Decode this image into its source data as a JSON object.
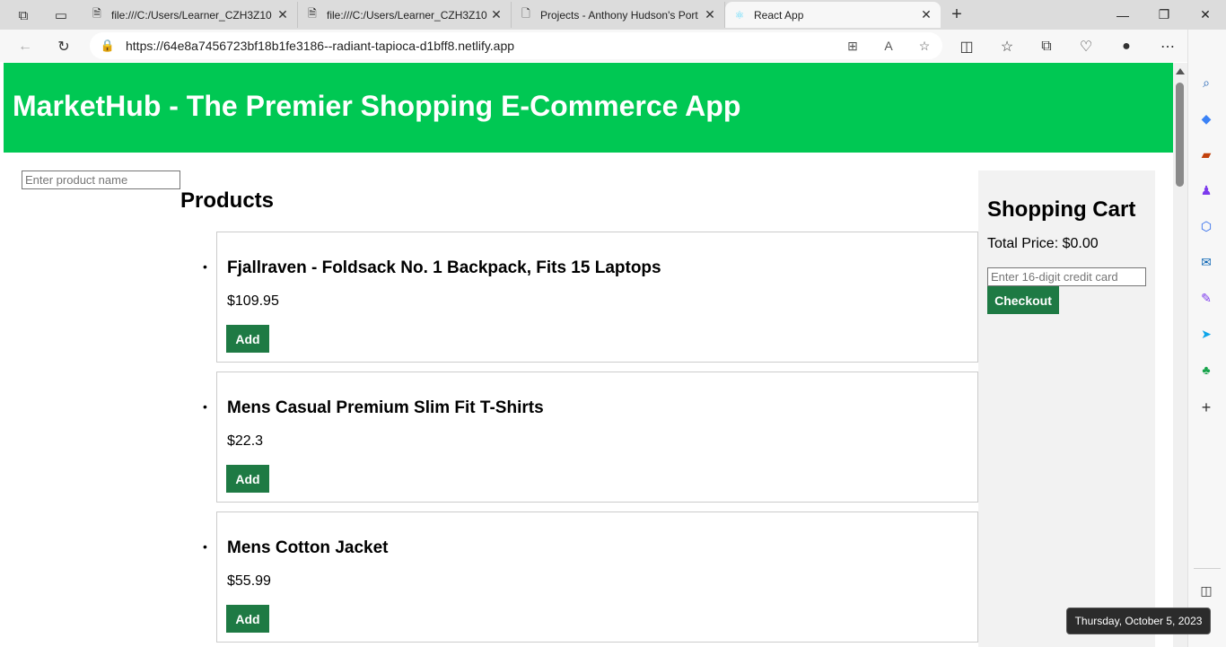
{
  "browser": {
    "tabs": [
      {
        "title": "file:///C:/Users/Learner_CZH3Z10",
        "icon": "file-pdf-icon",
        "active": false
      },
      {
        "title": "file:///C:/Users/Learner_CZH3Z10",
        "icon": "file-pdf-icon",
        "active": false
      },
      {
        "title": "Projects - Anthony Hudson's Port",
        "icon": "page-icon",
        "active": false
      },
      {
        "title": "React App",
        "icon": "react-icon",
        "active": true
      }
    ],
    "url": "https://64e8a7456723bf18b1fe3186--radiant-tapioca-d1bff8.netlify.app"
  },
  "app": {
    "title": "MarketHub - The Premier Shopping E-Commerce App",
    "search_placeholder": "Enter product name",
    "products_heading": "Products",
    "add_label": "Add",
    "products": [
      {
        "name": "Fjallraven - Foldsack No. 1 Backpack, Fits 15 Laptops",
        "price": "$109.95"
      },
      {
        "name": "Mens Casual Premium Slim Fit T-Shirts",
        "price": "$22.3"
      },
      {
        "name": "Mens Cotton Jacket",
        "price": "$55.99"
      }
    ],
    "cart": {
      "heading": "Shopping Cart",
      "total": "Total Price: $0.00",
      "cc_placeholder": "Enter 16-digit credit card",
      "checkout_label": "Checkout"
    }
  },
  "tooltip": "Thursday, October 5, 2023",
  "colors": {
    "header": "#00c853",
    "button": "#1e7a44",
    "cart_bg": "#f2f2f2"
  }
}
